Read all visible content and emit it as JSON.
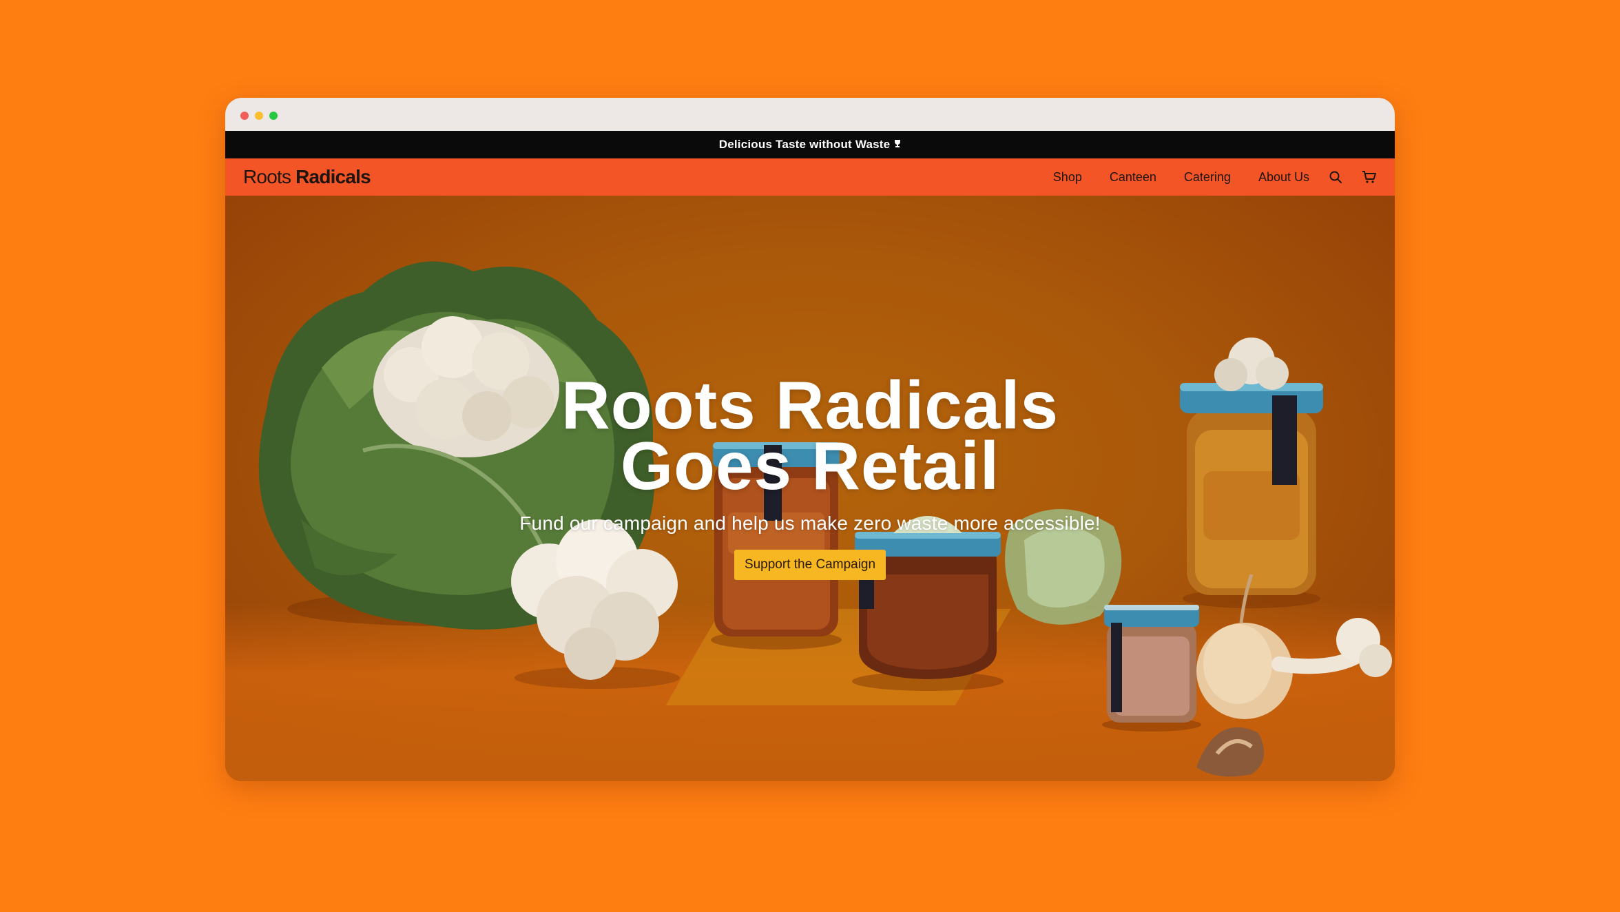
{
  "announcement": {
    "text": "Delicious Taste without Waste",
    "icon": "trophy-icon"
  },
  "brand": {
    "light": "Roots",
    "bold": "Radicals"
  },
  "nav": {
    "links": [
      "Shop",
      "Canteen",
      "Catering",
      "About Us"
    ],
    "icons": [
      "search-icon",
      "cart-icon"
    ]
  },
  "hero": {
    "title_line1": "Roots Radicals",
    "title_line2": "Goes Retail",
    "subtitle": "Fund our campaign and help us make zero waste more accessible!",
    "cta_label": "Support the Campaign"
  },
  "colors": {
    "page_bg": "#FF7E12",
    "chrome": "#EDE7E5",
    "announcement_bg": "#0A0A0A",
    "nav_bg": "#F45526",
    "cta_bg": "#F6B722"
  }
}
